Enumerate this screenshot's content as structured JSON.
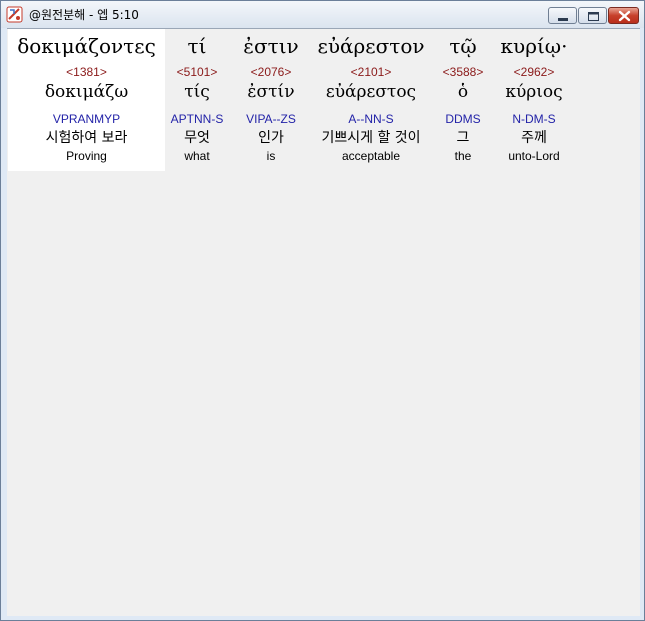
{
  "window": {
    "title": "@원전분해 - 엡 5:10",
    "buttons": {
      "minimize_icon": "minimize-icon",
      "maximize_icon": "maximize-icon",
      "close_icon": "close-icon"
    }
  },
  "words": [
    {
      "greek": "δοκιμάζοντες",
      "strongs": "<1381>",
      "lemma": "δοκιμάζω",
      "parsing": "VPRANMYP",
      "korean": "시험하여 보라",
      "english": "Proving",
      "selected": true
    },
    {
      "greek": "τί",
      "strongs": "<5101>",
      "lemma": "τίς",
      "parsing": "APTNN-S",
      "korean": "무엇",
      "english": "what",
      "selected": false
    },
    {
      "greek": "ἐστιν",
      "strongs": "<2076>",
      "lemma": "ἐστίν",
      "parsing": "VIPA--ZS",
      "korean": "인가",
      "english": "is",
      "selected": false
    },
    {
      "greek": "εὐάρεστον",
      "strongs": "<2101>",
      "lemma": "εὐάρεστος",
      "parsing": "A--NN-S",
      "korean": "기쁘시게 할 것이",
      "english": "acceptable",
      "selected": false
    },
    {
      "greek": "τῷ",
      "strongs": "<3588>",
      "lemma": "ὁ",
      "parsing": "DDMS",
      "korean": "그",
      "english": "the",
      "selected": false
    },
    {
      "greek": "κυρίῳ·",
      "strongs": "<2962>",
      "lemma": "κύριος",
      "parsing": "N-DM-S",
      "korean": "주께",
      "english": "unto-Lord",
      "selected": false
    }
  ],
  "colors": {
    "strongs": "#8b1a1a",
    "parsing": "#2323a8",
    "selected_background": "#ffffff",
    "client_background": "#f0f0f0"
  }
}
